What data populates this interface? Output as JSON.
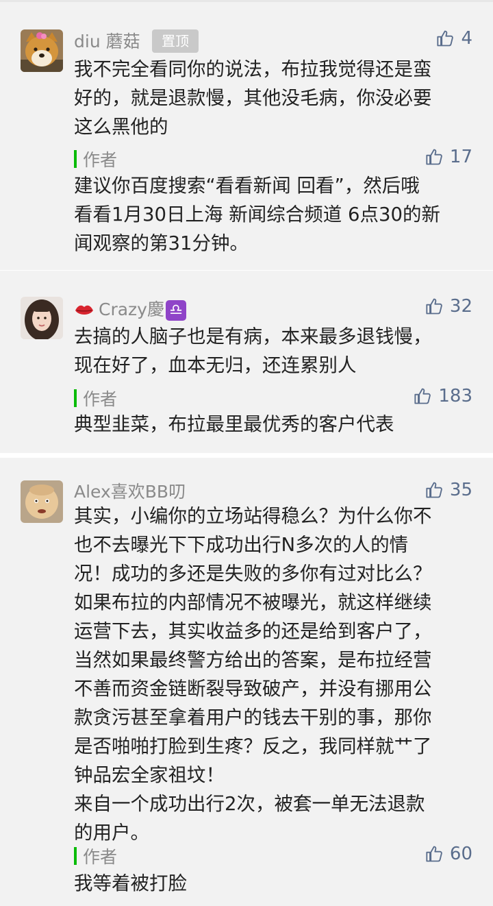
{
  "comments": [
    {
      "username": "diu 蘑菇",
      "badge": "置顶",
      "likes": "4",
      "lines": [
        "我不完全看同你的说法，布拉我觉得还是蛮",
        "好的，就是退款慢，其他没毛病，你没必要",
        "这么黑他的"
      ],
      "reply": {
        "author_label": "作者",
        "likes": "17",
        "lines": [
          "建议你百度搜索“看看新闻 回看”，然后哦",
          "看看1月30日上海 新闻综合频道 6点30的新",
          "闻观察的第31分钟。"
        ]
      }
    },
    {
      "username": "Crazy慶",
      "name_emoji": "lips-emoji",
      "name_symbol": "♎",
      "likes": "32",
      "lines": [
        "去搞的人脑子也是有病，本来最多退钱慢，",
        "现在好了，血本无归，还连累别人"
      ],
      "reply": {
        "author_label": "作者",
        "likes": "183",
        "lines": [
          "典型韭菜，布拉最里最优秀的客户代表"
        ]
      }
    },
    {
      "username": "Alex喜欢BB叨",
      "likes": "35",
      "lines": [
        "其实，小编你的立场站得稳么？为什么你不",
        "也不去曝光下下成功出行N多次的人的情",
        "况！成功的多还是失败的多你有过对比么？",
        "如果布拉的内部情况不被曝光，就这样继续",
        "运营下去，其实收益多的还是给到客户了，",
        "当然如果最终警方给出的答案，是布拉经营",
        "不善而资金链断裂导致破产，并没有挪用公",
        "款贪污甚至拿着用户的钱去干别的事，那你",
        "是否啪啪打脸到生疼？反之，我同样就艹了",
        "钟品宏全家祖坟！",
        "来自一个成功出行2次，被套一单无法退款",
        "的用户。"
      ],
      "reply": {
        "author_label": "作者",
        "likes": "60",
        "lines": [
          "我等着被打脸"
        ]
      }
    }
  ],
  "icons": {
    "like": "thumbs-up-icon"
  },
  "colors": {
    "card_bg": "#f2f2f2",
    "author_bar": "#09bb07",
    "like": "#5a6d8c",
    "muted": "#8a8a8a"
  }
}
